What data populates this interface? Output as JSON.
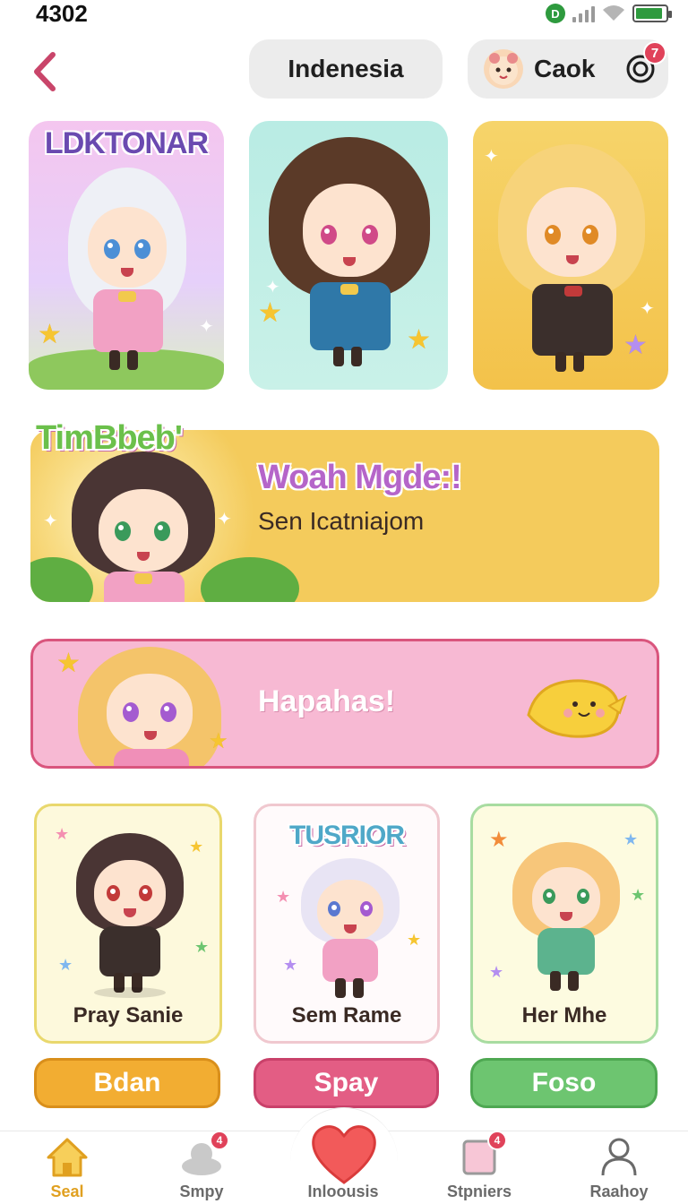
{
  "status_bar": {
    "time": "4302",
    "carrier_icon": "D",
    "battery_level": 0.9
  },
  "header": {
    "back_icon": "chevron-left-icon",
    "language_label": "Indenesia",
    "user_name": "Caok",
    "notification_count": "7"
  },
  "top_cards": [
    {
      "title": "LDKTONAR"
    },
    {
      "title": ""
    },
    {
      "title": ""
    }
  ],
  "featured_banner": {
    "tag": "TimBbeb'",
    "heading": "Woah Mgde:!",
    "subtext": "Sen Icatniajom"
  },
  "promo_banner": {
    "text": "Hapahas!"
  },
  "character_tiles": [
    {
      "title": "",
      "name": "Pray Sanie"
    },
    {
      "title": "TUSRIOR",
      "name": "Sem Rame"
    },
    {
      "title": "",
      "name": "Her Mhe"
    }
  ],
  "actions": [
    {
      "label": "Bdan"
    },
    {
      "label": "Spay"
    },
    {
      "label": "Foso"
    }
  ],
  "bottom_nav": [
    {
      "label": "Seal",
      "icon": "home-icon",
      "active": true
    },
    {
      "label": "Smpy",
      "icon": "cloud-icon",
      "badge": "4"
    },
    {
      "label": "Inloousis",
      "icon": "heart-icon"
    },
    {
      "label": "Stpniers",
      "icon": "card-icon",
      "badge": "4"
    },
    {
      "label": "Raahoy",
      "icon": "profile-icon"
    }
  ],
  "colors": {
    "accent_pink": "#e35d84",
    "accent_yellow": "#f4cb5c",
    "accent_green": "#6dc570",
    "badge_red": "#e0425a"
  }
}
